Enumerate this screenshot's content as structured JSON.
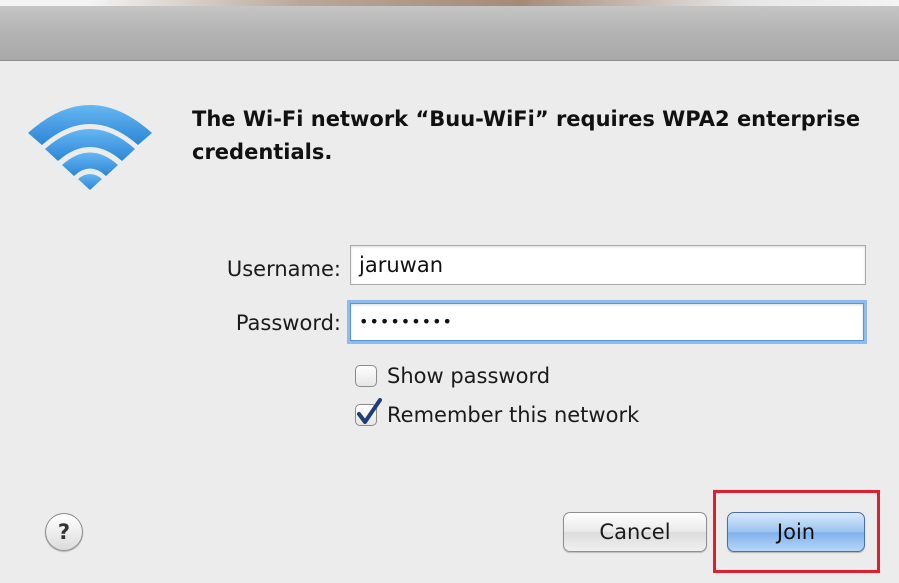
{
  "dialog": {
    "message": "The Wi-Fi network “Buu-WiFi” requires WPA2 enterprise credentials."
  },
  "icons": {
    "wifi": "wifi-icon",
    "help": "question-mark-icon",
    "checkmark": "checkmark-icon"
  },
  "form": {
    "username_label": "Username:",
    "username_value": "jaruwan",
    "password_label": "Password:",
    "password_value": "•••••••••",
    "show_password": {
      "label": "Show password",
      "checked": false
    },
    "remember_network": {
      "label": "Remember this network",
      "checked": true
    }
  },
  "buttons": {
    "help": "?",
    "cancel": "Cancel",
    "join": "Join"
  },
  "colors": {
    "wifi_blue": "#3a95e0",
    "focus_ring": "#8dbbee",
    "join_button": "#9cc3f0",
    "highlight": "#e01e2d"
  }
}
